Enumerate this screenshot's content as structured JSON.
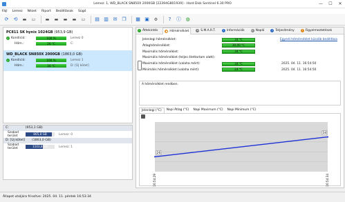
{
  "window": {
    "title": "Lemez: 1, WD_BLACK SN850X 2000GB [22394G801939] - Hard Disk Sentinel 6.30 PRO",
    "controls": [
      "—",
      "☐",
      "✕"
    ]
  },
  "menu": [
    "Fájl",
    "Lemez",
    "Nézet",
    "Riport",
    "Beállítások",
    "Súgó"
  ],
  "disks": [
    {
      "name": "PC811 SK hynix 1024GB",
      "size": "(953,9 GB)",
      "health_label": "Kondíció:",
      "health_value": "100 %",
      "health_pct": 1.0,
      "health_after": "Lemez 0",
      "temp_label": "Hőm.:",
      "temp_value": "26 °C",
      "temp_after": "C:"
    },
    {
      "name": "WD_BLACK SN850X 2000GB",
      "size": "(1863,0 GB)",
      "health_label": "Kondíció:",
      "health_value": "100 %",
      "health_pct": 1.0,
      "health_after": "Lemez 1",
      "temp_label": "Hőm.:",
      "temp_value": "34 °C",
      "temp_after": "D: [Új kötet]"
    }
  ],
  "partitions": [
    {
      "drive": "C:",
      "size": "(953,1 GB)",
      "free_label": "Szabad terület",
      "free_value": "865,8 GB",
      "free_pct": 0.91,
      "disk": "Lemez: 0"
    },
    {
      "drive": "D: [Új kötet]",
      "size": "(1863,0 GB)",
      "free_label": "Szabad terület",
      "free_value": "1103,8 GB",
      "free_pct": 0.59,
      "disk": "Lemez: 1"
    }
  ],
  "tabs": [
    "Áttekintés",
    "Hőmérséklet",
    "S.M.A.R.T.",
    "Információk",
    "Napló",
    "Teljesítmény",
    "Figyelmeztetések"
  ],
  "temperatures": [
    {
      "label": "Jelenlegi hőmérséklet:",
      "value": "34 °C",
      "date": "",
      "link": "Egyedi hőmérséklet küszöb beállítása"
    },
    {
      "label": "Átlaghőmérséklet:",
      "value": "30,00 °C",
      "date": "",
      "link": ""
    },
    {
      "label": "Maximális hőmérséklet:",
      "value": "34 °C",
      "date": "",
      "link": ""
    },
    {
      "label": "Maximális hőmérséklet (teljes élettartam alatt):",
      "value": "",
      "date": "",
      "link": ""
    },
    {
      "label": "Maximális hőmérséklet (valaha mért):",
      "value": "34 °C",
      "date": "2025. 04. 11. 16:54:50",
      "link": ""
    },
    {
      "label": "Minimális hőmérséklet (valaha mért):",
      "value": "24 °C",
      "date": "2025. 04. 11. 16:54:50",
      "link": ""
    }
  ],
  "status_message": "A hőmérséklet rendben.",
  "chart_tabs": [
    "Jelenlegi (°C)",
    "Napi Átlag (°C)",
    "Napi Maximum (°C)",
    "Napi Minimum (°C)"
  ],
  "chart_data": {
    "type": "line",
    "x": [
      "16:54:29",
      "16:54:34"
    ],
    "series": [
      {
        "values": [
          26,
          34
        ]
      }
    ],
    "data_labels": [
      "26",
      "34"
    ],
    "grid": true
  },
  "statusbar": "Állapot utoljára frissítve: 2025. 04. 11. péntek 16:53:34",
  "colors": {
    "health_bar": "#22a322",
    "partition_bar": "#2c4a86",
    "chart_line": "#1c2fd6",
    "selected_row": "#cce8ff"
  }
}
